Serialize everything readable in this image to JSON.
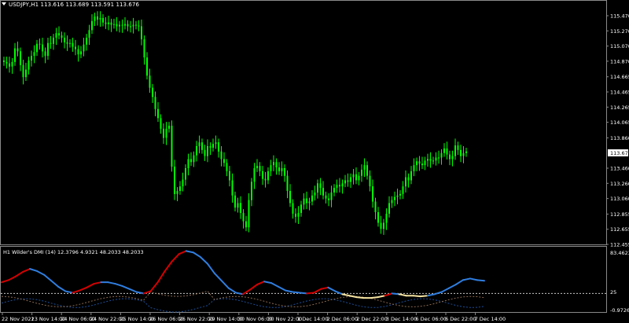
{
  "main_chart": {
    "header": "USDJPY,H1  113.616 113.689 113.591 113.676",
    "current_price": "113.676",
    "price_axis": [
      "115.470",
      "115.270",
      "115.070",
      "114.870",
      "114.665",
      "114.465",
      "114.265",
      "114.065",
      "113.860",
      "113.460",
      "113.260",
      "113.060",
      "112.855",
      "112.655",
      "112.455"
    ],
    "candle_color": "#00ff00",
    "closes": [
      114.86,
      114.84,
      114.8,
      114.86,
      115.04,
      115.0,
      114.82,
      114.66,
      114.76,
      114.88,
      114.94,
      114.99,
      115.1,
      115.09,
      115.0,
      114.94,
      115.11,
      115.1,
      115.18,
      115.24,
      115.21,
      115.18,
      115.12,
      115.1,
      115.11,
      115.06,
      115.03,
      114.96,
      115.0,
      115.09,
      115.18,
      115.28,
      115.4,
      115.46,
      115.42,
      115.44,
      115.38,
      115.36,
      115.38,
      115.35,
      115.36,
      115.33,
      115.35,
      115.34,
      115.36,
      115.33,
      115.33,
      115.35,
      115.34,
      115.33,
      115.16,
      114.92,
      114.68,
      114.52,
      114.4,
      114.24,
      114.12,
      113.98,
      113.86,
      113.98,
      114.02,
      113.48,
      113.12,
      113.16,
      113.22,
      113.31,
      113.46,
      113.58,
      113.54,
      113.63,
      113.75,
      113.8,
      113.7,
      113.62,
      113.75,
      113.73,
      113.78,
      113.8,
      113.68,
      113.58,
      113.53,
      113.42,
      113.3,
      113.1,
      112.94,
      113.0,
      112.87,
      112.76,
      112.68,
      113.04,
      113.28,
      113.46,
      113.49,
      113.42,
      113.32,
      113.3,
      113.42,
      113.5,
      113.54,
      113.47,
      113.42,
      113.46,
      113.36,
      113.16,
      113.0,
      112.86,
      112.82,
      112.87,
      112.98,
      113.06,
      113.0,
      113.02,
      113.1,
      113.14,
      113.26,
      113.2,
      113.1,
      113.06,
      113.04,
      113.14,
      113.2,
      113.24,
      113.22,
      113.26,
      113.3,
      113.28,
      113.34,
      113.38,
      113.3,
      113.36,
      113.44,
      113.5,
      113.36,
      113.22,
      113.02,
      112.88,
      112.74,
      112.66,
      112.74,
      112.86,
      113.0,
      113.04,
      113.08,
      113.1,
      113.12,
      113.22,
      113.34,
      113.3,
      113.42,
      113.5,
      113.55,
      113.52,
      113.5,
      113.56,
      113.58,
      113.56,
      113.56,
      113.6,
      113.6,
      113.66,
      113.72,
      113.64,
      113.58,
      113.62,
      113.76,
      113.7,
      113.62,
      113.66,
      113.68
    ],
    "time_axis": [
      "22 Nov 2021",
      "23 Nov 14:00",
      "24 Nov 06:00",
      "24 Nov 22:00",
      "25 Nov 14:00",
      "26 Nov 06:00",
      "26 Nov 22:00",
      "29 Nov 14:00",
      "30 Nov 06:00",
      "30 Nov 22:00",
      "1 Dec 14:00",
      "2 Dec 06:00",
      "2 Dec 22:00",
      "3 Dec 14:00",
      "6 Dec 06:00",
      "6 Dec 22:00",
      "7 Dec 14:00"
    ]
  },
  "indicator": {
    "header": "H1 Wilder's DMI (14) 12.3796 4.9321 48.2033 48.2033",
    "axis_top": "83.4623",
    "axis_mid": "25",
    "axis_bottom": "-0.9726",
    "adx_values": [
      40,
      43,
      48,
      54,
      58,
      55,
      50,
      42,
      34,
      28,
      26,
      29,
      33,
      38,
      40,
      40,
      38,
      35,
      31,
      27,
      25,
      28,
      40,
      55,
      68,
      78,
      82,
      80,
      74,
      65,
      52,
      42,
      32,
      26,
      24,
      30,
      37,
      41,
      39,
      34,
      29,
      27,
      26,
      25,
      26,
      31,
      33,
      28,
      24,
      22,
      20,
      19,
      19,
      20,
      22,
      25,
      24,
      22,
      22,
      21,
      22,
      24,
      27,
      32,
      37,
      43,
      45,
      43,
      42
    ],
    "colors": {
      "rising": "#d40000",
      "falling": "#2f7ee0",
      "flat": "#f4e3a1",
      "plus_di": "#1c4f9a",
      "minus_di": "#8a6a52",
      "level": "#c8c8c8"
    }
  }
}
